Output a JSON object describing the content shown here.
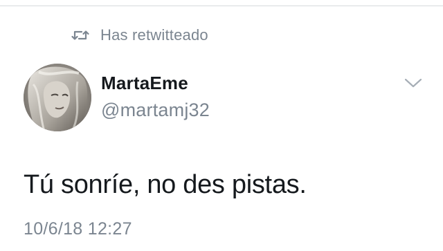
{
  "retweet": {
    "icon": "retweet-icon",
    "label": "Has retwitteado"
  },
  "tweet": {
    "author": {
      "display_name": "MartaEme",
      "handle": "@martamj32",
      "avatar": "avatar-photo"
    },
    "menu_icon": "chevron-down-icon",
    "text": "Tú sonríe, no des pistas.",
    "timestamp": "10/6/18 12:27"
  },
  "colors": {
    "primary_text": "#15191d",
    "secondary_text": "#7b8590",
    "divider": "#d6d9dc",
    "background": "#ffffff"
  }
}
